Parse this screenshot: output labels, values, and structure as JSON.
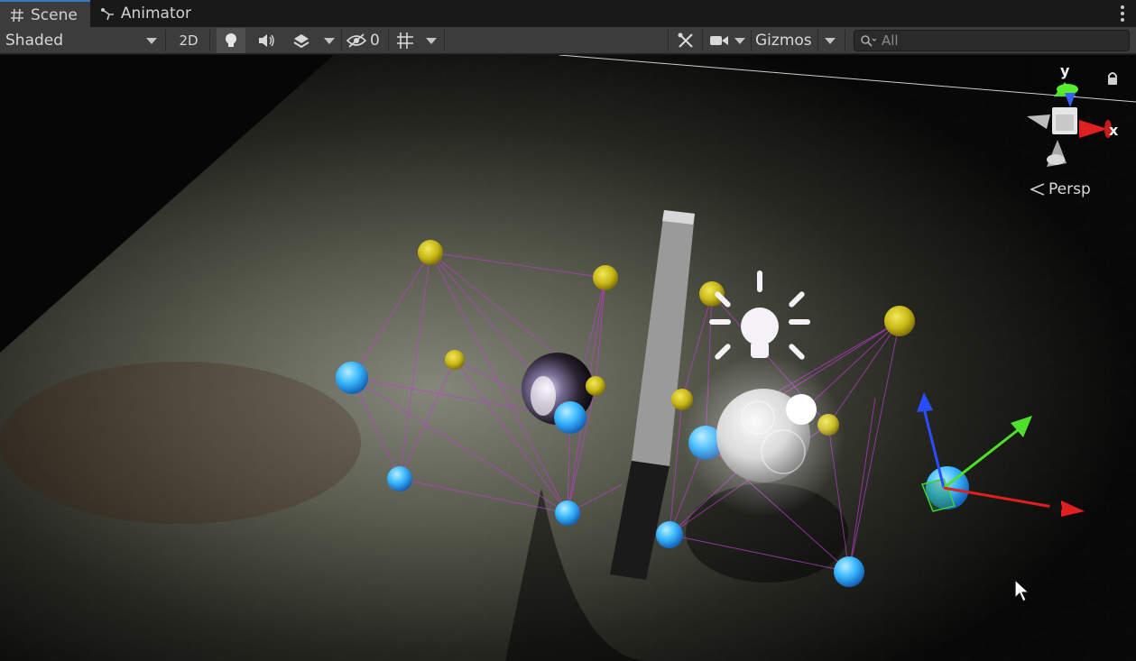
{
  "tabs": [
    {
      "label": "Scene",
      "icon": "hash-icon",
      "active": true
    },
    {
      "label": "Animator",
      "icon": "animator-icon",
      "active": false
    }
  ],
  "toolbar": {
    "draw_mode": "Shaded",
    "mode_2d": "2D",
    "hidden_count": "0",
    "gizmos": "Gizmos",
    "search_placeholder": "All"
  },
  "scene": {
    "orientation_label": "Persp",
    "axis_y": "y",
    "axis_x": "x"
  },
  "colors": {
    "accent": "#3a79bb",
    "probe_yellow": "#d6c81a",
    "probe_blue": "#3ab8ff",
    "probe_lines": "#c23ad6"
  }
}
